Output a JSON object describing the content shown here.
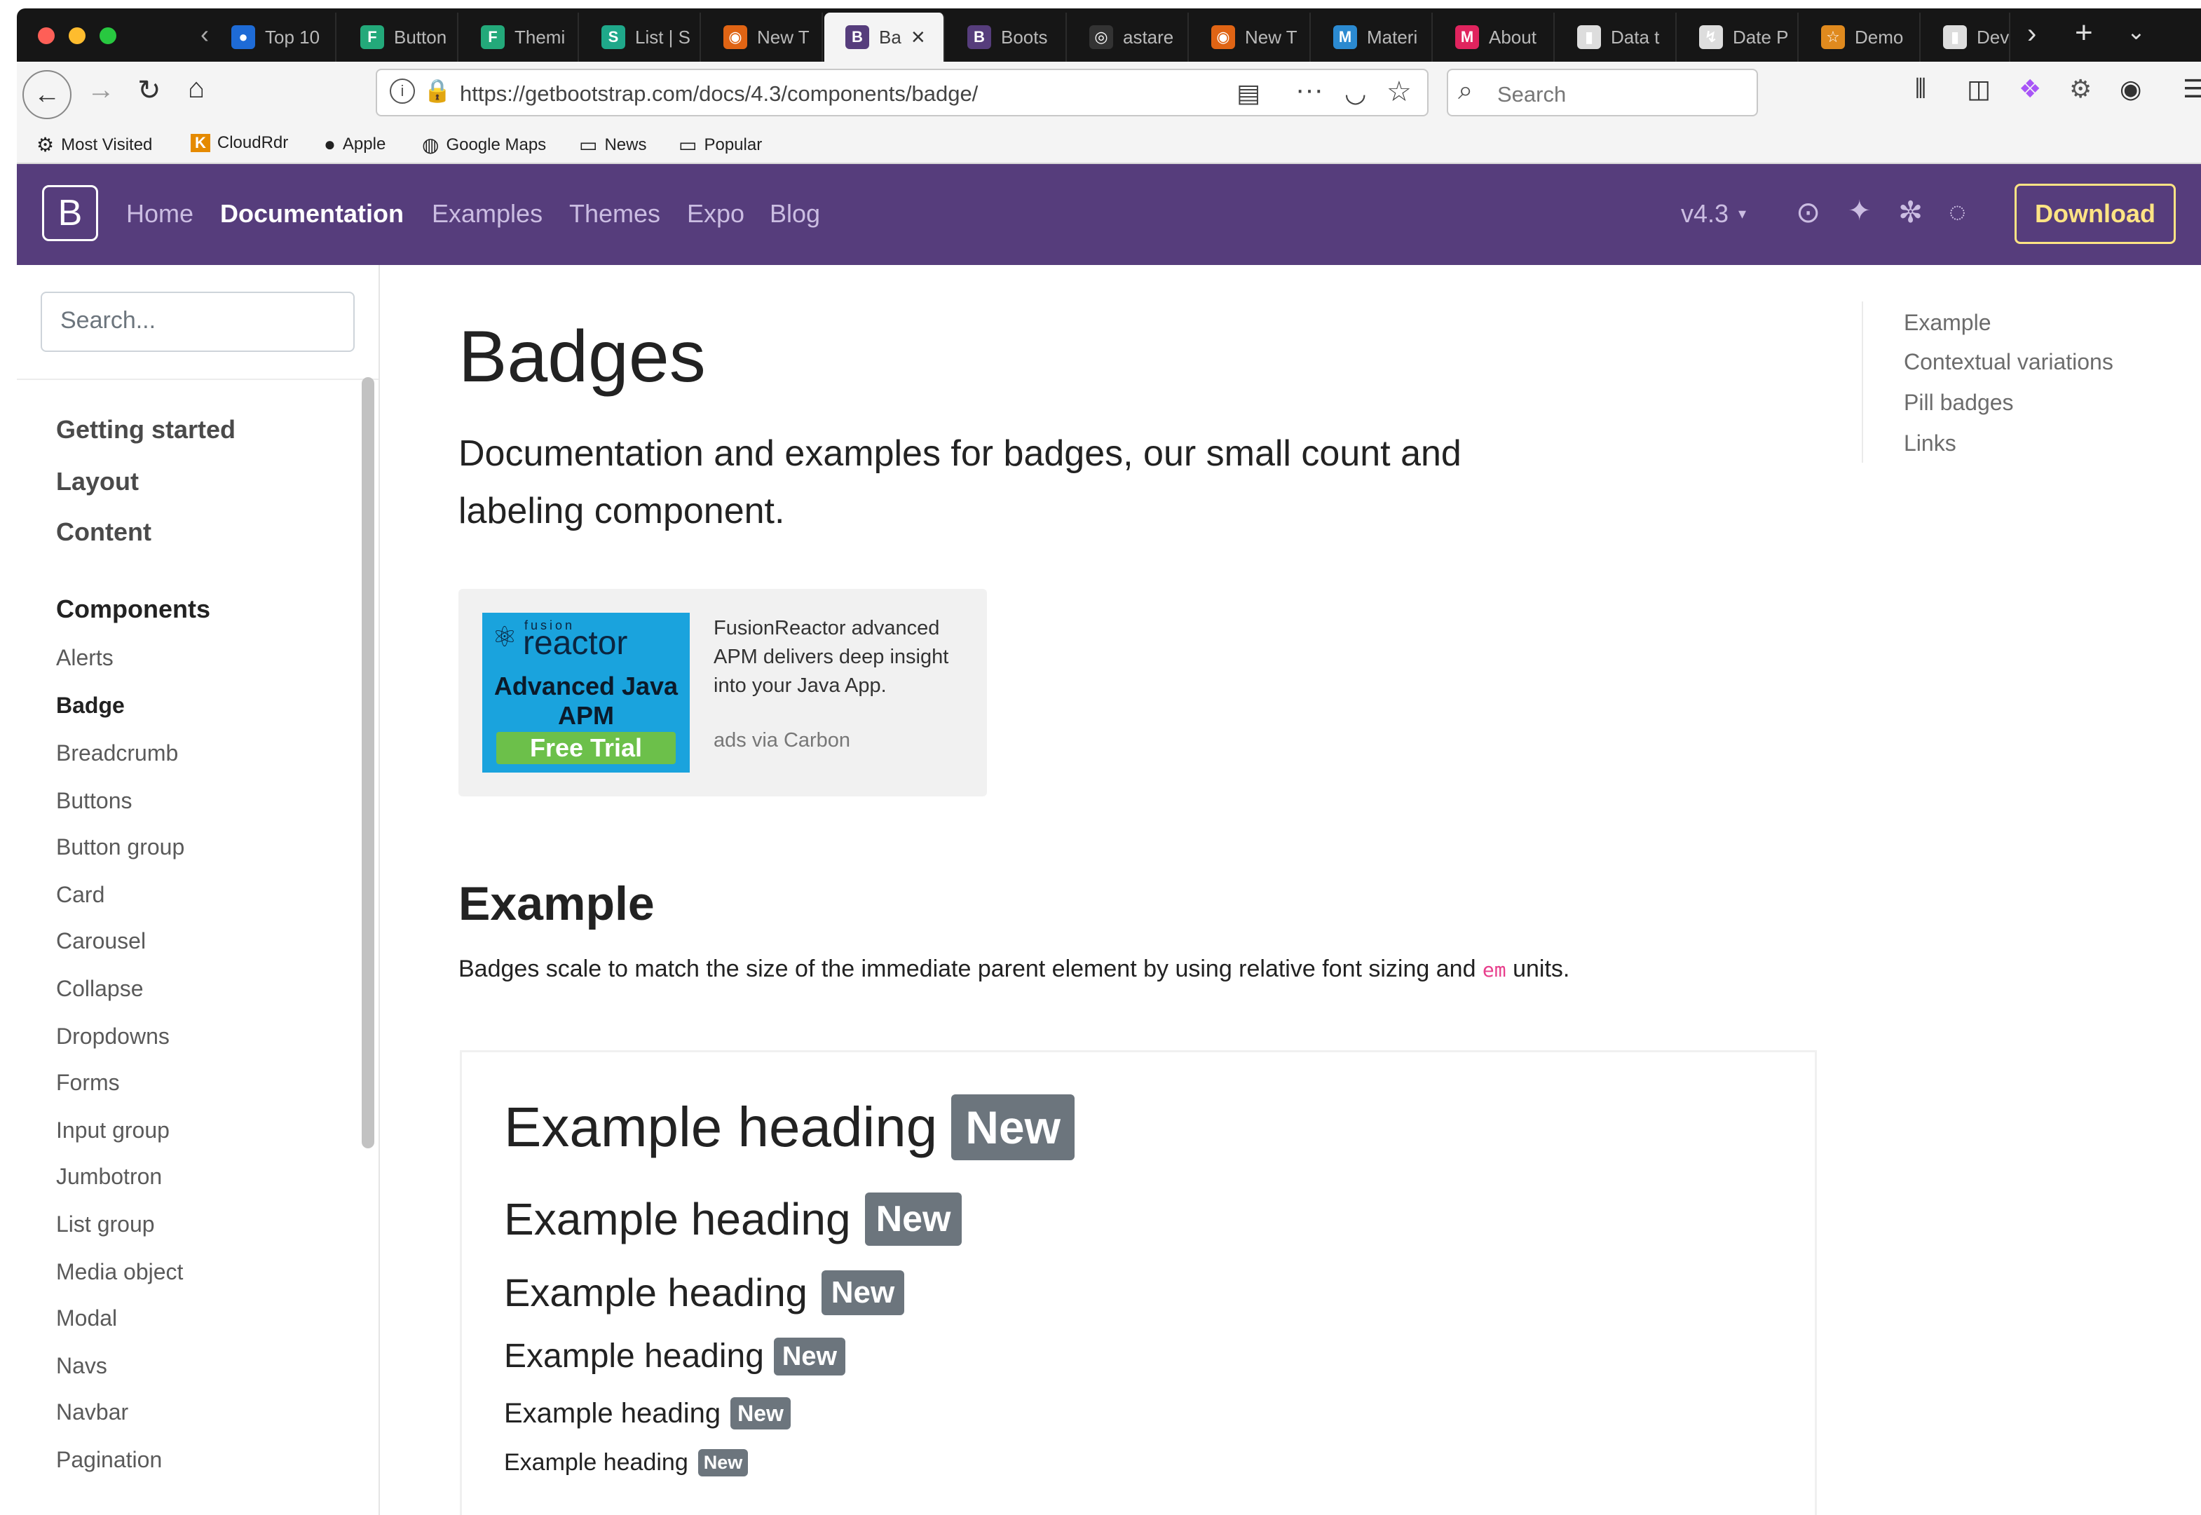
{
  "browser": {
    "tabs": [
      {
        "label": "Top 10",
        "icon": "circle-icon",
        "color": "#1e6bd6"
      },
      {
        "label": "Button",
        "icon": "f-icon",
        "color": "#23a97a"
      },
      {
        "label": "Themi",
        "icon": "f-icon",
        "color": "#23a97a"
      },
      {
        "label": "List | S",
        "icon": "s-icon",
        "color": "#1fa88a"
      },
      {
        "label": "New T",
        "icon": "firefox-icon",
        "color": "#e06414"
      },
      {
        "label": "Ba",
        "icon": "bootstrap-icon",
        "color": "#563d7c"
      },
      {
        "label": "Boots",
        "icon": "bootstrap-icon",
        "color": "#563d7c"
      },
      {
        "label": "astare",
        "icon": "github-icon",
        "color": "#333333"
      },
      {
        "label": "New T",
        "icon": "firefox-icon",
        "color": "#e06414"
      },
      {
        "label": "Materi",
        "icon": "m-icon",
        "color": "#2b8ad1"
      },
      {
        "label": "About",
        "icon": "m-icon",
        "color": "#e0245e"
      },
      {
        "label": "Data t",
        "icon": "doc-icon",
        "color": "#dddddd"
      },
      {
        "label": "Date P",
        "icon": "swirl-icon",
        "color": "#dddddd"
      },
      {
        "label": "Demo",
        "icon": "star-icon",
        "color": "#e08a1e"
      },
      {
        "label": "Dev",
        "icon": "doc-icon",
        "color": "#dddddd"
      }
    ],
    "url": "https://getbootstrap.com/docs/4.3/components/badge/",
    "search_placeholder": "Search",
    "bookmarks": [
      {
        "label": "Most Visited",
        "icon": "gear-icon"
      },
      {
        "label": "CloudRdr",
        "icon": "k-icon"
      },
      {
        "label": "Apple",
        "icon": "apple-icon"
      },
      {
        "label": "Google Maps",
        "icon": "globe-icon"
      },
      {
        "label": "News",
        "icon": "folder-icon"
      },
      {
        "label": "Popular",
        "icon": "folder-icon"
      }
    ]
  },
  "navbar": {
    "brand": "B",
    "links": [
      "Home",
      "Documentation",
      "Examples",
      "Themes",
      "Expo",
      "Blog"
    ],
    "active": "Documentation",
    "version": "v4.3",
    "download": "Download",
    "brand_color": "#563d7c",
    "accent": "#ffe484"
  },
  "sidebar": {
    "search_placeholder": "Search...",
    "sections": [
      "Getting started",
      "Layout",
      "Content",
      "Components"
    ],
    "items": [
      "Alerts",
      "Badge",
      "Breadcrumb",
      "Buttons",
      "Button group",
      "Card",
      "Carousel",
      "Collapse",
      "Dropdowns",
      "Forms",
      "Input group",
      "Jumbotron",
      "List group",
      "Media object",
      "Modal",
      "Navs",
      "Navbar",
      "Pagination"
    ],
    "active": "Badge"
  },
  "main": {
    "title": "Badges",
    "lead": "Documentation and examples for badges, our small count and labeling component.",
    "ad": {
      "image_text_1": "fusion",
      "image_text_2": "reactor",
      "image_text_3": "Advanced Java",
      "image_text_4": "APM",
      "image_cta": "Free Trial",
      "text": "FusionReactor advanced APM delivers deep insight into your Java App.",
      "via": "ads via Carbon"
    },
    "example_title": "Example",
    "example_desc_before": "Badges scale to match the size of the immediate parent element by using relative font sizing and ",
    "example_desc_code": "em",
    "example_desc_after": " units.",
    "heading_text": "Example heading",
    "badge_text": "New",
    "badge_color": "#6c757d"
  },
  "toc": [
    "Example",
    "Contextual variations",
    "Pill badges",
    "Links"
  ]
}
